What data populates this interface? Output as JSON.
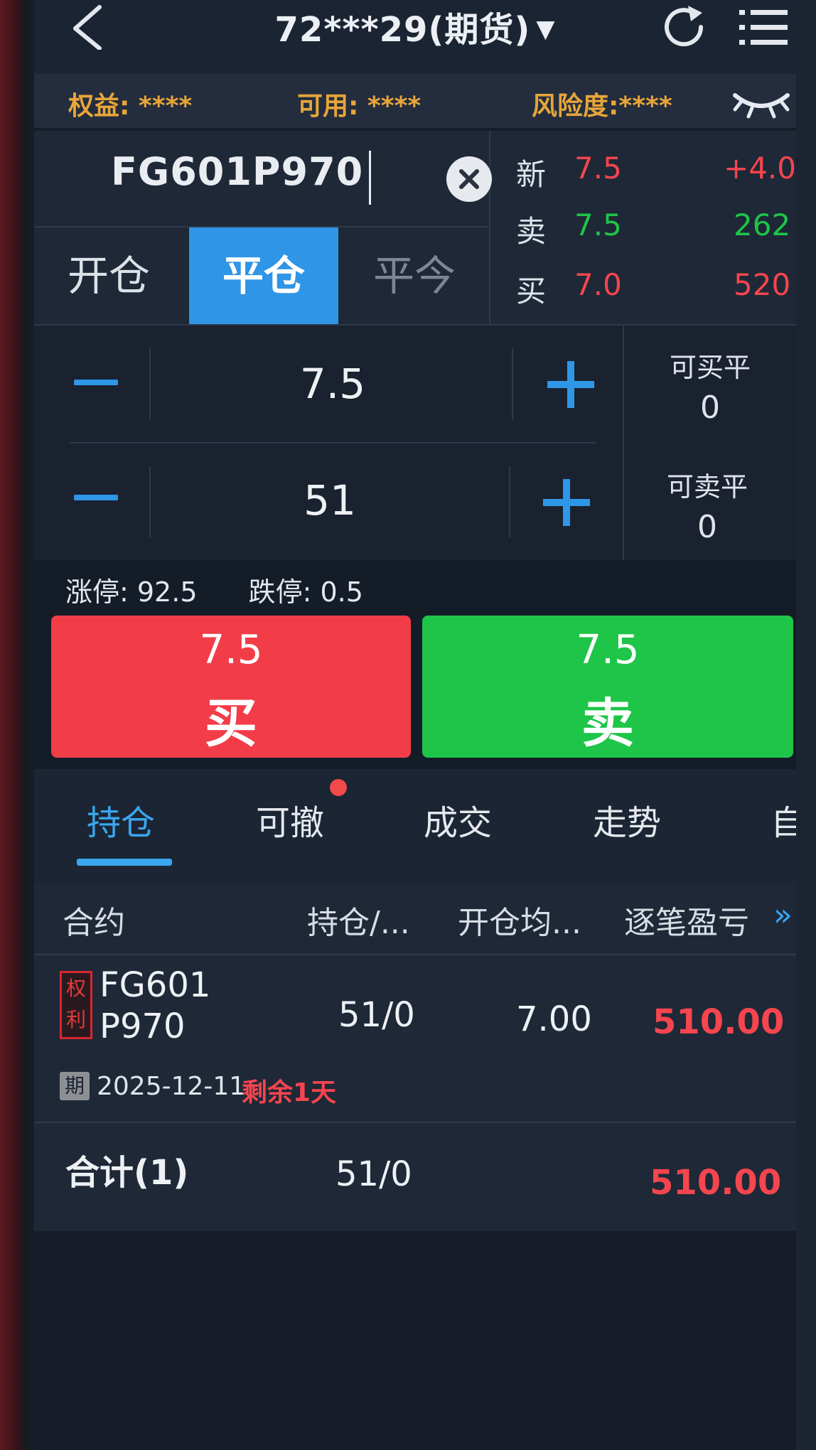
{
  "header": {
    "title": "72***29(期货)",
    "dropdown_arrow": "▼",
    "icons": {
      "back": "chevron-left-icon",
      "refresh": "refresh-icon",
      "menu": "menu-icon"
    }
  },
  "account": {
    "equity": "权益: ****",
    "available": "可用: ****",
    "risk": "风险度:****"
  },
  "search": {
    "value": "FG601P970"
  },
  "order_type_tabs": [
    {
      "label": "开仓",
      "active": false
    },
    {
      "label": "平仓",
      "active": true
    },
    {
      "label": "平今",
      "active": false
    }
  ],
  "quote": [
    {
      "label": "新",
      "price": "7.5",
      "change": "+4.0"
    },
    {
      "label": "卖",
      "price": "7.5",
      "volume": "262"
    },
    {
      "label": "买",
      "price": "7.0",
      "volume": "520"
    }
  ],
  "price_stepper": {
    "value": "7.5"
  },
  "qty_stepper": {
    "value": "51"
  },
  "available": {
    "buy_close_label": "可买平",
    "buy_close_value": "0",
    "sell_close_label": "可卖平",
    "sell_close_value": "0"
  },
  "limits": {
    "up": "涨停: 92.5",
    "down": "跌停: 0.5"
  },
  "buttons": {
    "buy": {
      "price": "7.5",
      "label": "买"
    },
    "sell": {
      "price": "7.5",
      "label": "卖"
    }
  },
  "tabs": [
    {
      "label": "持仓",
      "active": true
    },
    {
      "label": "可撤",
      "active": false
    },
    {
      "label": "成交",
      "active": false
    },
    {
      "label": "走势",
      "active": false
    },
    {
      "label": "自",
      "active": false
    }
  ],
  "table": {
    "headers": [
      "合约",
      "持仓/...",
      "开仓均...",
      "逐笔盈亏"
    ],
    "more": "»",
    "rows": [
      {
        "badge": "权利",
        "contract_line1": "FG601",
        "contract_line2": "P970",
        "position": "51/0",
        "avg_open": "7.00",
        "pnl": "510.00",
        "expiry_badge": "期",
        "expiry_date": "2025-12-11",
        "remaining": "剩余1天"
      }
    ],
    "total": {
      "label": "合计(1)",
      "position": "51/0",
      "pnl": "510.00"
    }
  },
  "colors": {
    "up_red": "#f5454e",
    "down_green": "#1ec548",
    "accent_blue": "#3aa6ee",
    "gold": "#e8a53a"
  }
}
